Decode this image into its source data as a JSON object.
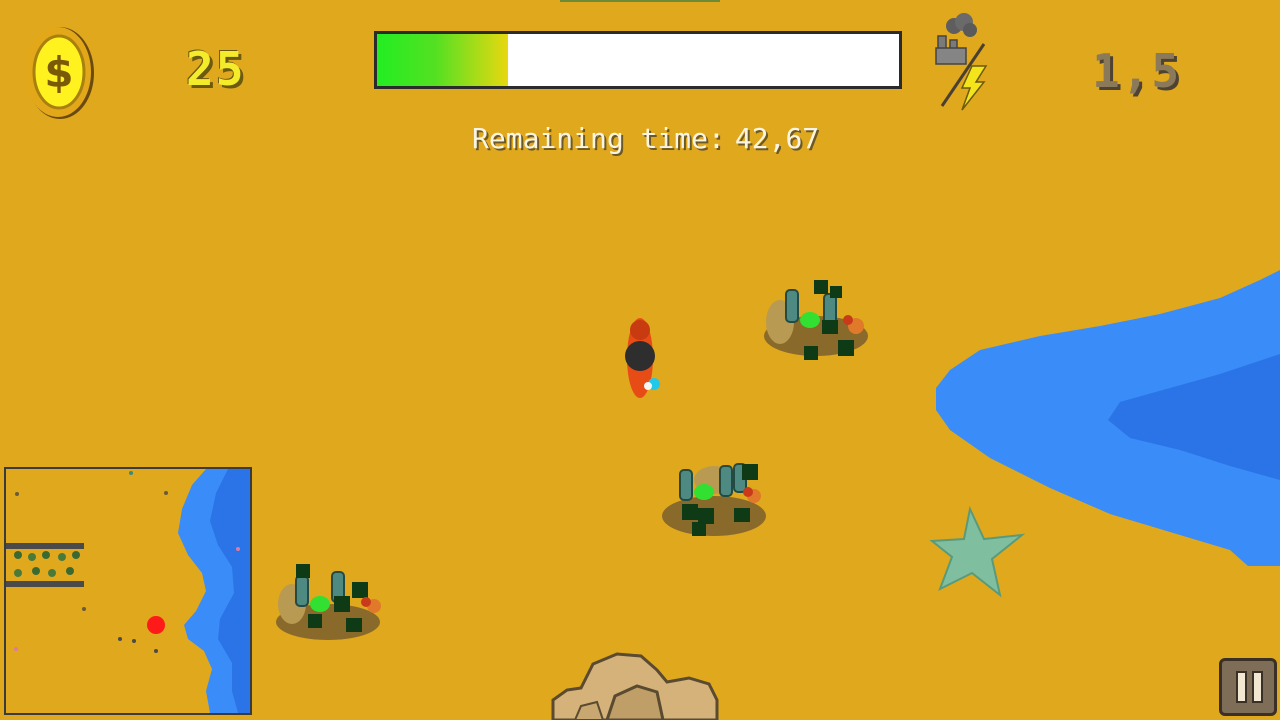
{
  "hud": {
    "coins": "25",
    "time_progress": 0.25,
    "remaining_label": "Remaining time:",
    "remaining_value": "42,67",
    "pollution_multiplier": "1,5"
  },
  "icons": {
    "coin": "coin-dollar-icon",
    "pollution": "factory-smoke-lightning-icon",
    "pause": "pause-icon"
  },
  "world": {
    "trash_piles": 3,
    "starfish": 1,
    "rock": 1
  },
  "colors": {
    "sand": "#e0a81c",
    "water": "#3a8cf8",
    "water_deep": "#2a74e8",
    "coin_text": "#f4ec2a",
    "multiplier_text": "#8a7a5a"
  }
}
